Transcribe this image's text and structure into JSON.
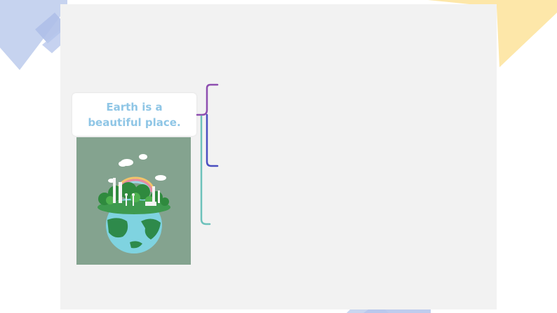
{
  "slide": {
    "title": "Earth is a beautiful place.",
    "image": "earth-city-papercut-illustration"
  },
  "colors": {
    "background": "#ffffff",
    "slide": "#f2f2f2",
    "title_text": "#8fc6e6",
    "bracket_purple": "#8e4fb0",
    "bracket_blue": "#4a4fc0",
    "bracket_teal": "#6cc1bb",
    "deco_blue": "#c6d3ef",
    "deco_yellow": "#fde7a9",
    "image_bg": "#84a38f"
  }
}
